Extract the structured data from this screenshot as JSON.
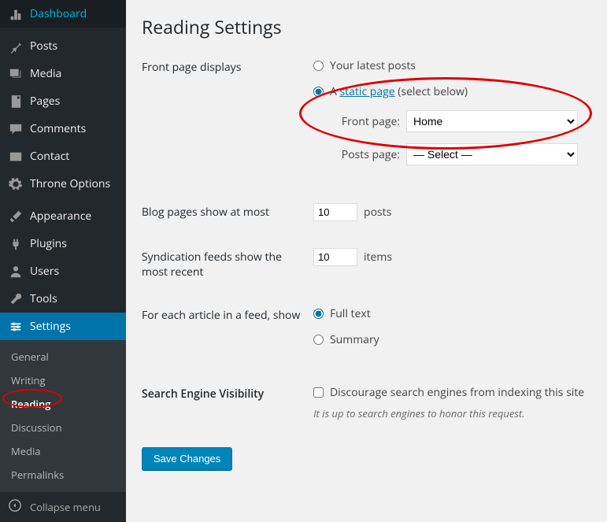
{
  "sidebar": [
    {
      "icon": "dashboard",
      "label": "Dashboard"
    },
    {
      "sep": true
    },
    {
      "icon": "pin",
      "label": "Posts"
    },
    {
      "icon": "media",
      "label": "Media"
    },
    {
      "icon": "page",
      "label": "Pages"
    },
    {
      "icon": "comment",
      "label": "Comments"
    },
    {
      "icon": "mail",
      "label": "Contact"
    },
    {
      "icon": "gear",
      "label": "Throne Options"
    },
    {
      "sep": true
    },
    {
      "icon": "brush",
      "label": "Appearance"
    },
    {
      "icon": "plug",
      "label": "Plugins"
    },
    {
      "icon": "user",
      "label": "Users"
    },
    {
      "icon": "wrench",
      "label": "Tools"
    },
    {
      "icon": "sliders",
      "label": "Settings",
      "active": true
    }
  ],
  "submenu": [
    {
      "label": "General"
    },
    {
      "label": "Writing"
    },
    {
      "label": "Reading",
      "current": true
    },
    {
      "label": "Discussion"
    },
    {
      "label": "Media"
    },
    {
      "label": "Permalinks"
    }
  ],
  "collapse_label": "Collapse menu",
  "page_title": "Reading Settings",
  "rows": {
    "front_page": {
      "label": "Front page displays",
      "opt1": "Your latest posts",
      "opt2_prefix": "A ",
      "opt2_link": "static page",
      "opt2_suffix": " (select below)",
      "front_label": "Front page:",
      "front_value": "Home",
      "posts_label": "Posts page:",
      "posts_value": "— Select —"
    },
    "blog_pages": {
      "label": "Blog pages show at most",
      "value": "10",
      "suffix": "posts"
    },
    "syndication": {
      "label": "Syndication feeds show the most recent",
      "value": "10",
      "suffix": "items"
    },
    "feed": {
      "label": "For each article in a feed, show",
      "opt1": "Full text",
      "opt2": "Summary"
    },
    "seo": {
      "label": "Search Engine Visibility",
      "checkbox": "Discourage search engines from indexing this site",
      "desc": "It is up to search engines to honor this request."
    }
  },
  "save_label": "Save Changes"
}
